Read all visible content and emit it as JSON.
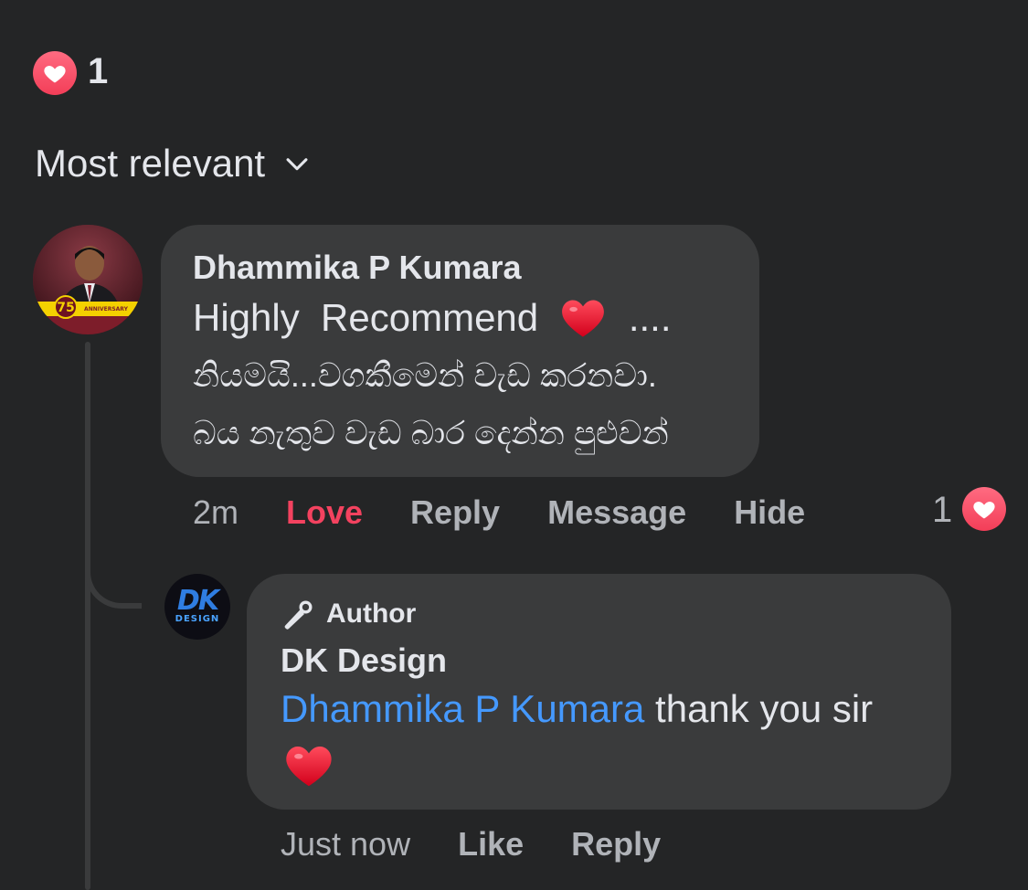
{
  "summary": {
    "reaction_count": "1",
    "reaction_icon": "heart-icon"
  },
  "sort": {
    "label": "Most relevant",
    "icon": "chevron-down-icon"
  },
  "comment": {
    "author": "Dhammika P Kumara",
    "avatar_badge_text": "ANNIVERSARY",
    "text_line1_before": "Highly  Recommend  ",
    "text_line1_after": "  ....",
    "text_line2": "නියමයි...වගකීමෙන් වැඩ කරනවා.",
    "text_line3": "බය නැතුව වැඩ බාර දෙන්න පුළුවන්",
    "time": "2m",
    "actions": {
      "love": "Love",
      "reply": "Reply",
      "message": "Message",
      "hide": "Hide"
    },
    "reaction_count": "1"
  },
  "reply": {
    "badge": "Author",
    "author": "DK Design",
    "avatar_text_big": "DK",
    "avatar_text_small": "DESIGN",
    "mention": "Dhammika P Kumara",
    "text": " thank you sir",
    "time": "Just now",
    "actions": {
      "like": "Like",
      "reply": "Reply"
    }
  },
  "colors": {
    "background": "#242526",
    "bubble": "#3a3b3c",
    "love": "#f3425f",
    "mention": "#4599ff",
    "secondary_text": "#b0b3b8"
  }
}
